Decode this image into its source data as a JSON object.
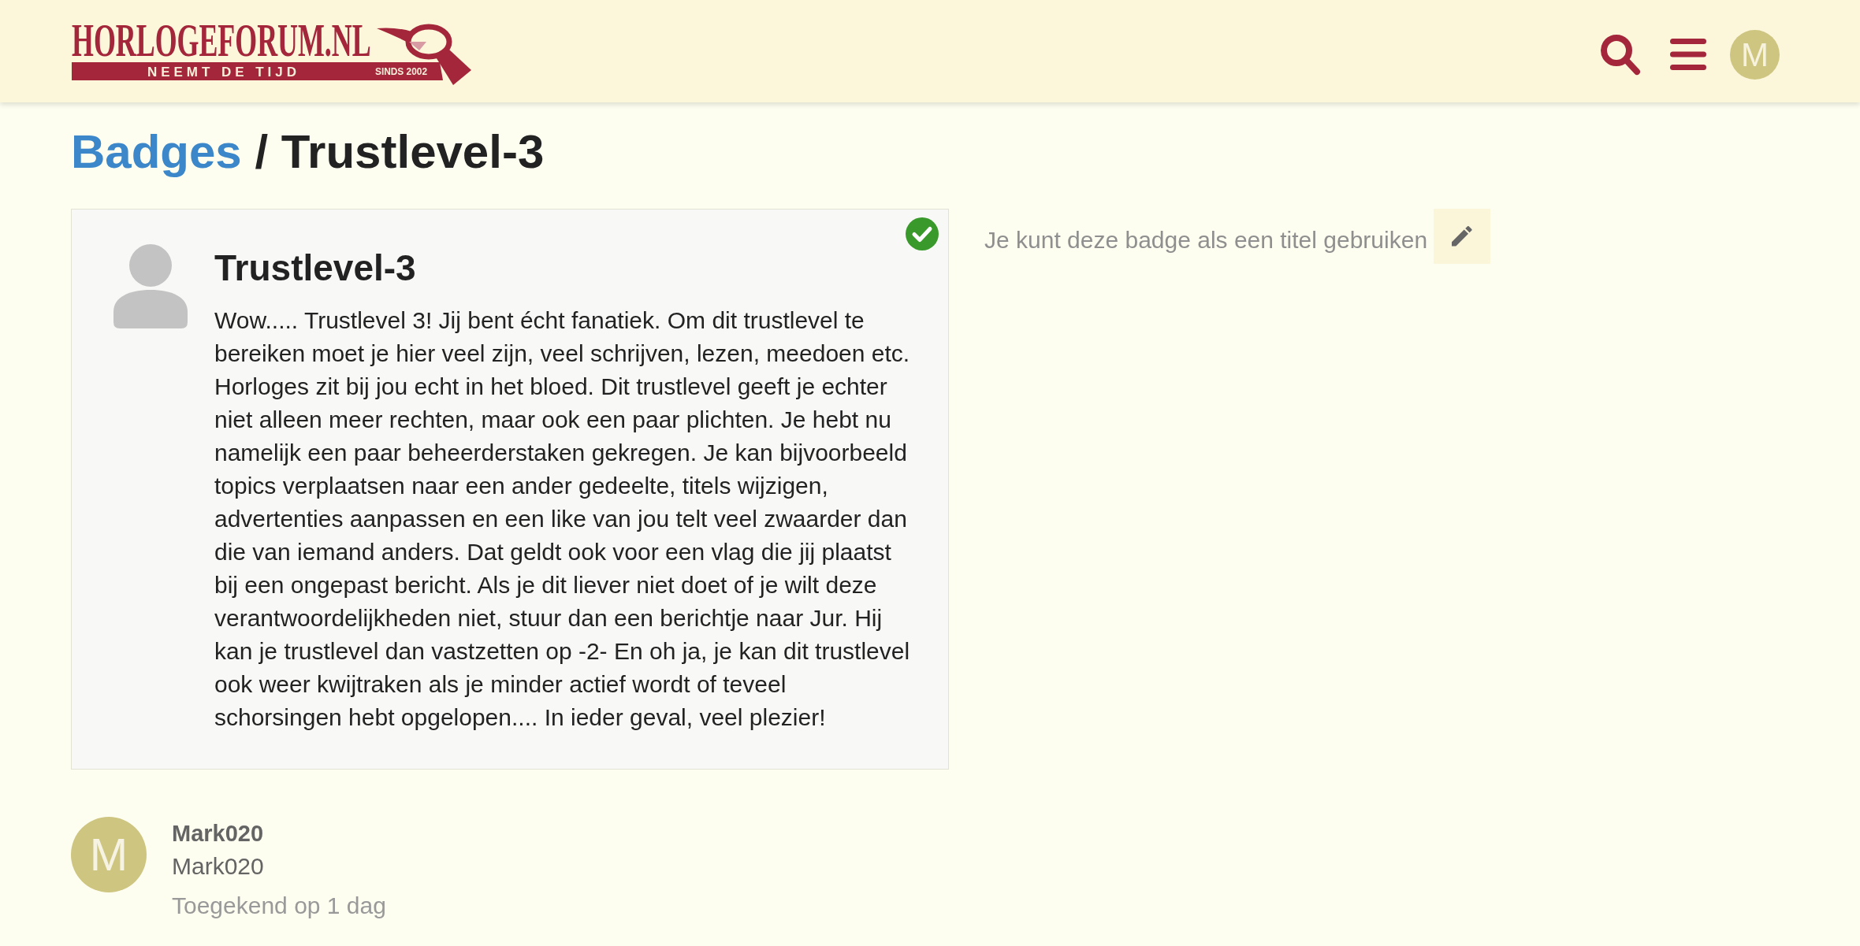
{
  "header": {
    "logo": {
      "wordmark": "HORLOGEFORUM.NL",
      "tagline": "NEEMT DE TIJD",
      "since": "SINDS 2002"
    },
    "user_avatar": {
      "initial": "M"
    }
  },
  "breadcrumb": {
    "parent": "Badges",
    "separator": "/",
    "current": "Trustlevel-3"
  },
  "badge": {
    "title": "Trustlevel-3",
    "granted": true,
    "description": "Wow..... Trustlevel 3! Jij bent écht fanatiek. Om dit trustlevel te bereiken moet je hier veel zijn, veel schrijven, lezen, meedoen etc. Horloges zit bij jou echt in het bloed. Dit trustlevel geeft je echter niet alleen meer rechten, maar ook een paar plichten. Je hebt nu namelijk een paar beheerderstaken gekregen. Je kan bijvoorbeeld topics verplaatsen naar een ander gedeelte, titels wijzigen, advertenties aanpassen en een like van jou telt veel zwaarder dan die van iemand anders. Dat geldt ook voor een vlag die jij plaatst bij een ongepast bericht. Als je dit liever niet doet of je wilt deze verantwoordelijkheden niet, stuur dan een berichtje naar Jur. Hij kan je trustlevel dan vastzetten op -2- En oh ja, je kan dit trustlevel ook weer kwijtraken als je minder actief wordt of teveel schorsingen hebt opgelopen.... In ieder geval, veel plezier!"
  },
  "title_hint": {
    "text": "Je kunt deze badge als een titel gebruiken"
  },
  "grants": [
    {
      "initial": "M",
      "username": "Mark020",
      "name": "Mark020",
      "granted": "Toegekend op 1 dag"
    }
  ]
}
